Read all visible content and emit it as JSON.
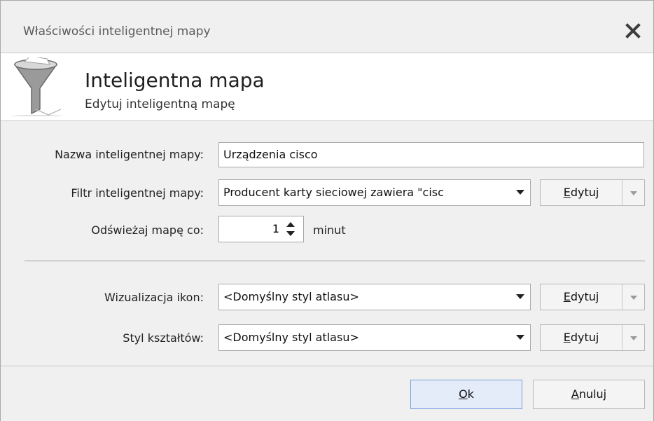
{
  "window": {
    "title": "Właściwości inteligentnej mapy"
  },
  "header": {
    "title": "Inteligentna mapa",
    "subtitle": "Edytuj inteligentną mapę"
  },
  "form": {
    "name_label": "Nazwa inteligentnej mapy:",
    "name_value": "Urządzenia cisco",
    "filter_label": "Filtr inteligentnej mapy:",
    "filter_value": "Producent karty sieciowej zawiera \"cisc",
    "refresh_label": "Odświeżaj mapę co:",
    "refresh_value": "1",
    "refresh_unit": "minut",
    "icons_label": "Wizualizacja ikon:",
    "icons_value": "<Domyślny styl atlasu>",
    "shapes_label": "Styl kształtów:",
    "shapes_value": "<Domyślny styl atlasu>",
    "edit_first": "E",
    "edit_rest": "dytuj"
  },
  "footer": {
    "ok_first": "O",
    "ok_rest": "k",
    "cancel_first": "A",
    "cancel_rest": "nuluj"
  },
  "icons": [
    "close-icon",
    "funnel-icon",
    "chevron-down-icon",
    "spin-up-icon",
    "spin-down-icon"
  ],
  "colors": {
    "ok_button_bg": "#e5ecf9",
    "ok_button_border": "#7a9fdc"
  }
}
